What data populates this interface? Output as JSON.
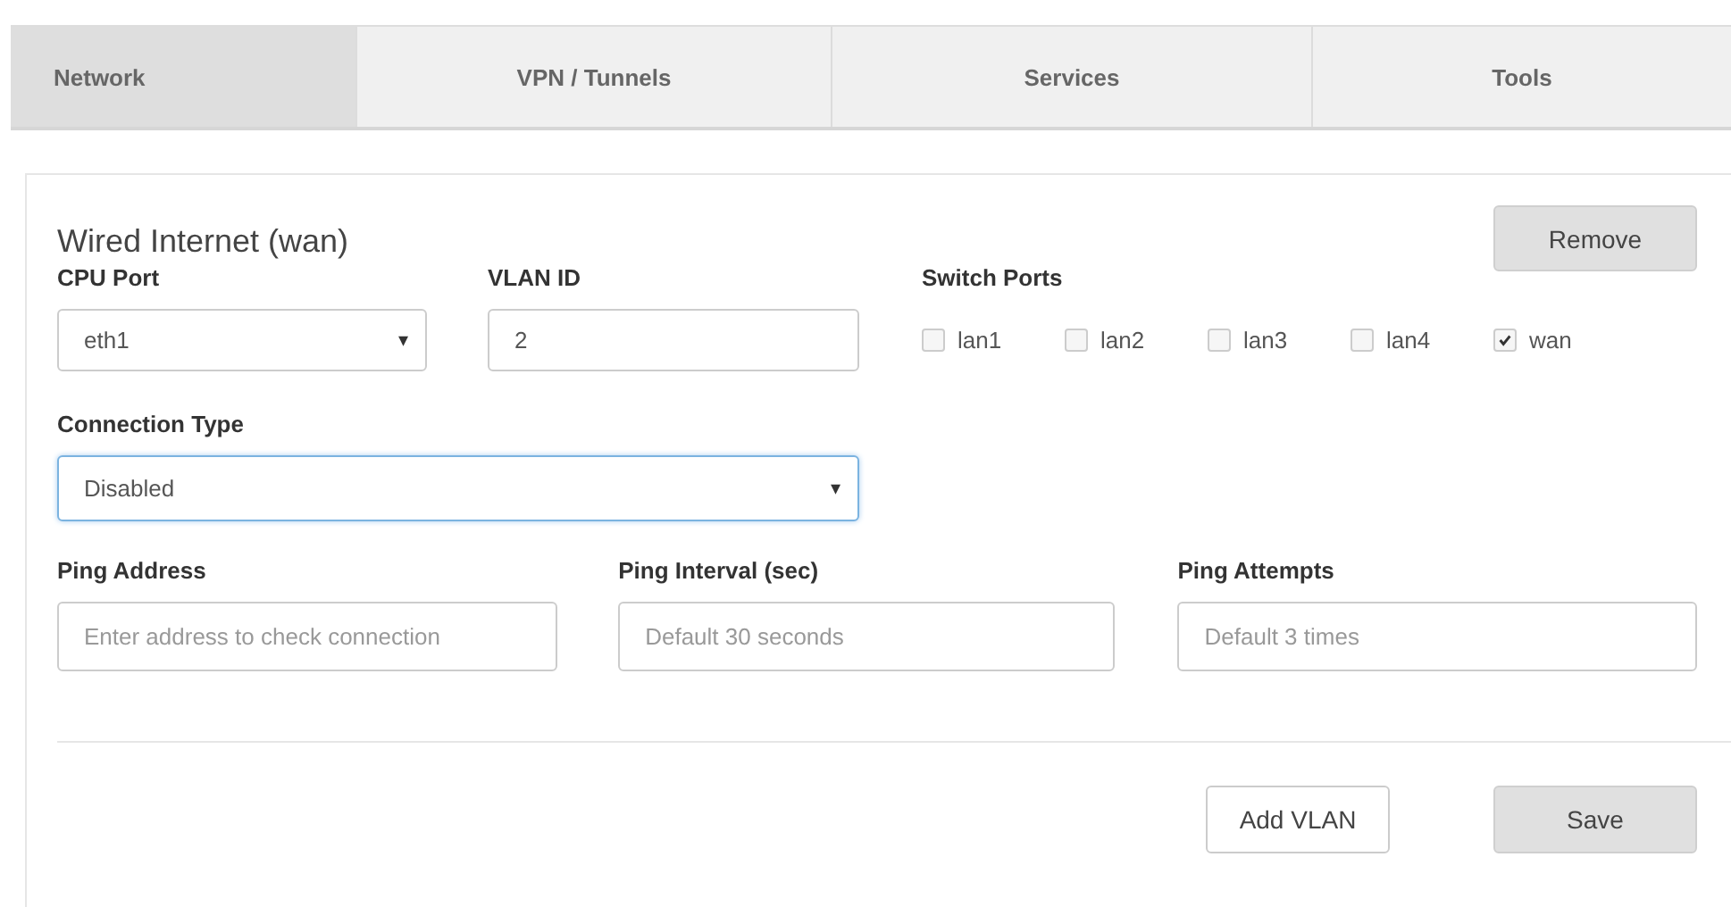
{
  "tabs": [
    {
      "label": "Network",
      "selected": true
    },
    {
      "label": "VPN / Tunnels",
      "selected": false
    },
    {
      "label": "Services",
      "selected": false
    },
    {
      "label": "Tools",
      "selected": false
    }
  ],
  "section": {
    "title": "Wired Internet (wan)",
    "remove_button": "Remove",
    "cpu_port": {
      "label": "CPU Port",
      "value": "eth1",
      "arrow": "▾"
    },
    "vlan_id": {
      "label": "VLAN ID",
      "value": "2"
    },
    "switch_ports": {
      "label": "Switch Ports",
      "ports": [
        {
          "label": "lan1",
          "checked": false
        },
        {
          "label": "lan2",
          "checked": false
        },
        {
          "label": "lan3",
          "checked": false
        },
        {
          "label": "lan4",
          "checked": false
        },
        {
          "label": "wan",
          "checked": true
        }
      ]
    },
    "connection_type": {
      "label": "Connection Type",
      "value": "Disabled",
      "arrow": "▾",
      "focused": true
    },
    "ping_fields": [
      {
        "label": "Ping Address",
        "placeholder": "Enter address to check connection"
      },
      {
        "label": "Ping Interval (sec)",
        "placeholder": "Default 30 seconds"
      },
      {
        "label": "Ping Attempts",
        "placeholder": "Default 3 times"
      }
    ],
    "buttons": [
      "Add VLAN",
      "Save"
    ]
  }
}
